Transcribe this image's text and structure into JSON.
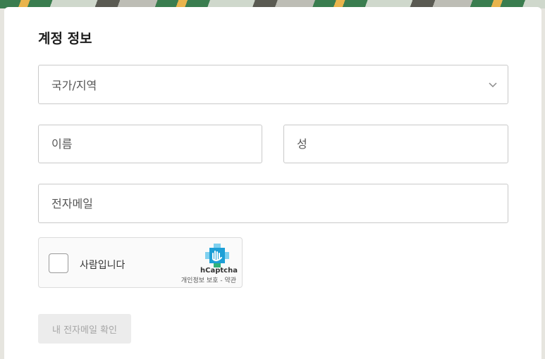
{
  "section_title": "계정 정보",
  "country_select": {
    "placeholder": "국가/지역"
  },
  "first_name": {
    "placeholder": "이름",
    "value": ""
  },
  "last_name": {
    "placeholder": "성",
    "value": ""
  },
  "email": {
    "placeholder": "전자메일",
    "value": ""
  },
  "captcha": {
    "checkbox_label": "사람입니다",
    "brand": "hCaptcha",
    "privacy_link": "개인정보 보호",
    "separator": "-",
    "terms_link": "약관"
  },
  "verify_button": "내 전자메일 확인",
  "colors": {
    "brand_blue": "#1e9fd6",
    "brand_green": "#2fb27a"
  }
}
